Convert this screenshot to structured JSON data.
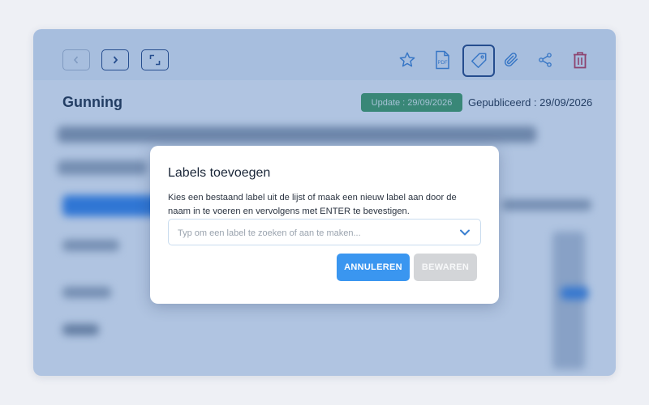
{
  "toolbar": {
    "items": [
      {
        "name": "back-button",
        "icon": "chevron-left-icon"
      },
      {
        "name": "forward-button",
        "icon": "chevron-right-icon"
      },
      {
        "name": "expand-button",
        "icon": "expand-icon"
      },
      {
        "name": "favorite-button",
        "icon": "star-icon"
      },
      {
        "name": "pdf-button",
        "icon": "pdf-icon",
        "label": "PDF"
      },
      {
        "name": "label-button",
        "icon": "tag-icon",
        "active": true
      },
      {
        "name": "attachment-button",
        "icon": "paperclip-icon"
      },
      {
        "name": "share-button",
        "icon": "share-icon"
      },
      {
        "name": "delete-button",
        "icon": "trash-icon"
      }
    ]
  },
  "page": {
    "title": "Gunning",
    "update_badge": "Update : 29/09/2026",
    "published": "Gepubliceerd : 29/09/2026"
  },
  "modal": {
    "title": "Labels toevoegen",
    "description": "Kies een bestaand label uit de lijst of maak een nieuw label aan door de naam in te voeren en vervolgens met ENTER te bevestigen.",
    "select_placeholder": "Typ om een label te zoeken of aan te maken...",
    "select_value": "",
    "cancel_label": "ANNULEREN",
    "save_label": "BEWAREN",
    "save_disabled": true
  },
  "colors": {
    "accent": "#3a96f0",
    "navy": "#1f3f7a",
    "badge_green": "#3d9a57",
    "danger": "#c0304a",
    "overlay": "#3166b2"
  }
}
